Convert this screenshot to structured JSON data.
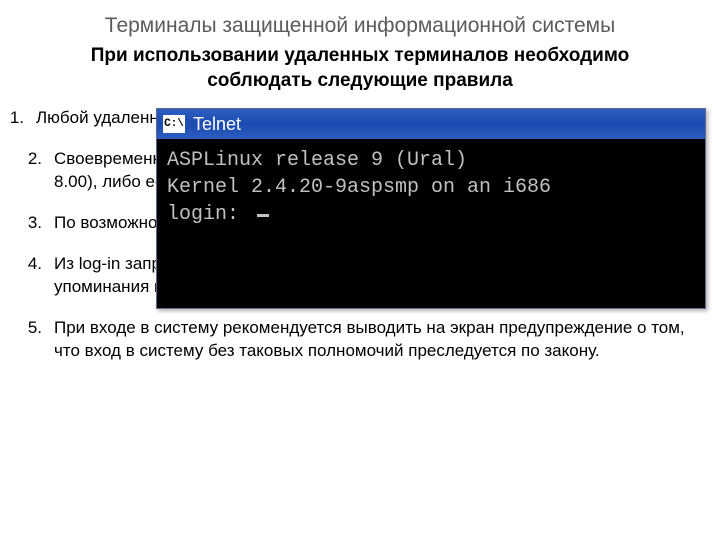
{
  "title": "Терминалы защищенной информационной системы",
  "subtitle": "При использовании удаленных терминалов необходимо соблюдать следующие правила",
  "rules": [
    {
      "num": "1.",
      "text": "Любой удаленный терминал должен запрашивать имя регистрации и пароль;"
    },
    {
      "num": "2.",
      "text": "Своевременно отключать все модемы, если оборудование (например, с 18.00 до 8.00), либо если они не контролируются."
    },
    {
      "num": "3.",
      "text": "По возможности рекомендуется использовать системы;"
    },
    {
      "num": "4.",
      "text": "Из log-in запроса терминала рекомендуется убрать все непосредственные упоминания имени фирмы, ее логотипы и т.п.;"
    },
    {
      "num": "5.",
      "text": "При входе в систему рекомендуется выводить на экран предупреждение о том, что вход в систему без таковых полномочий преследуется по закону."
    }
  ],
  "telnet": {
    "icon_label": "C:\\",
    "window_title": "Telnet",
    "line1": "ASPLinux release 9 (Ural)",
    "line2": "Kernel 2.4.20-9aspsmp on an i686",
    "prompt": "login: "
  }
}
